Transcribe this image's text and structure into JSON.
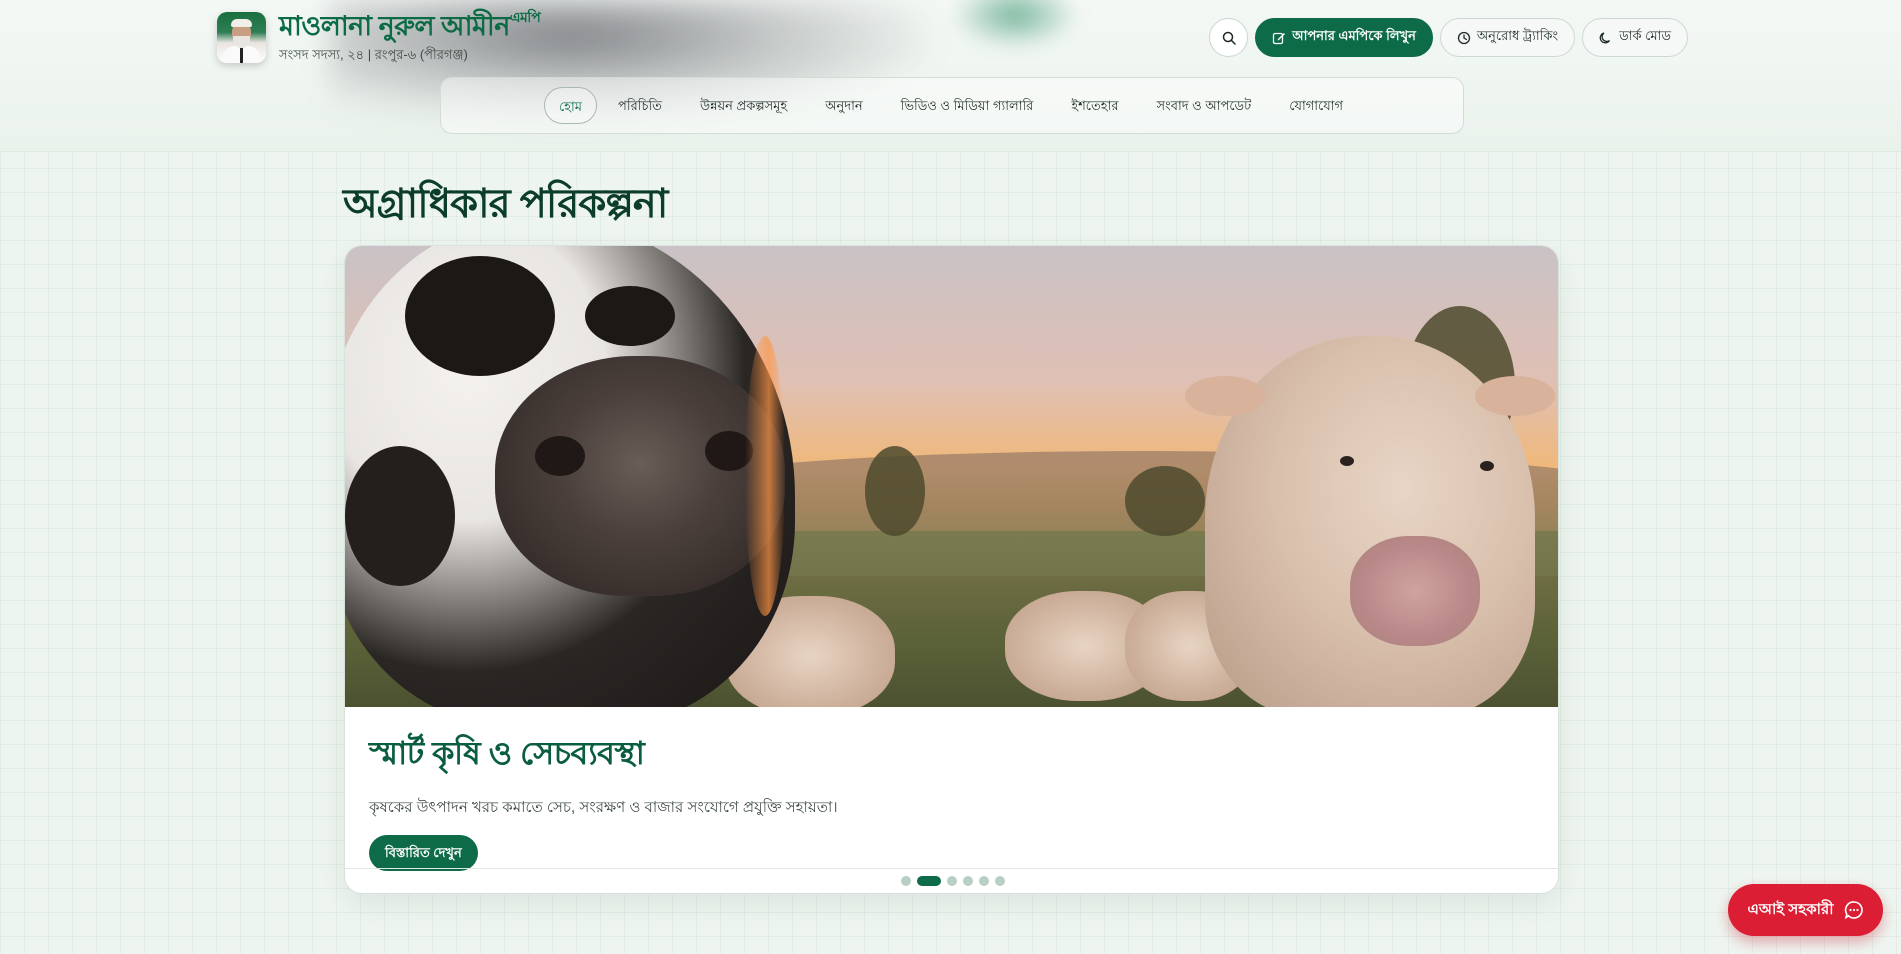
{
  "header": {
    "name": "মাওলানা নুরুল আমীন",
    "name_suffix": "এমপি",
    "subtitle": "সংসদ সদস্য, ২৪ | রংপুর-৬ (পীরগঞ্জ)",
    "search_icon": "search-icon",
    "actions": {
      "write": "আপনার এমপিকে লিখুন",
      "track": "অনুরোধ ট্র্যাকিং",
      "dark": "ডার্ক মোড"
    }
  },
  "nav": {
    "items": [
      "হোম",
      "পরিচিতি",
      "উন্নয়ন প্রকল্পসমূহ",
      "অনুদান",
      "ভিডিও ও মিডিয়া গ্যালারি",
      "ইশতেহার",
      "সংবাদ ও আপডেট",
      "যোগাযোগ"
    ],
    "active_index": 0
  },
  "main": {
    "section_title": "অগ্রাধিকার পরিকল্পনা",
    "slide": {
      "title": "স্মার্ট কৃষি ও সেচব্যবস্থা",
      "description": "কৃষকের উৎপাদন খরচ কমাতে সেচ, সংরক্ষণ ও বাজার সংযোগে প্রযুক্তি সহায়তা।",
      "button": "বিস্তারিত দেখুন"
    },
    "slider": {
      "count": 6,
      "active": 1
    }
  },
  "ai_assistant": {
    "label": "এআই সহকারী"
  },
  "colors": {
    "primary": "#0d6b48",
    "accent_red": "#dc1e35",
    "title": "#0b3d28"
  }
}
